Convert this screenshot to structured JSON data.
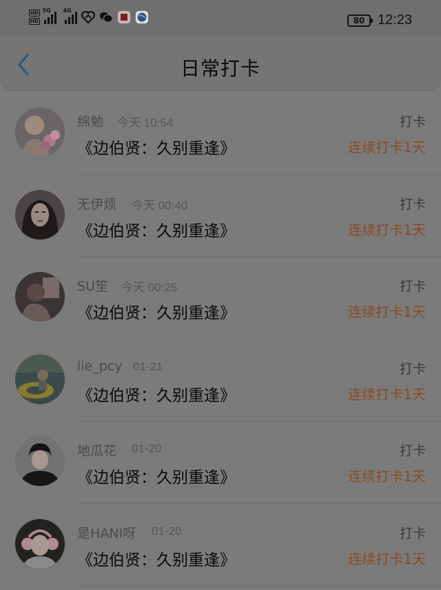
{
  "status_bar": {
    "hd1": "HD",
    "hd2": "HD",
    "net1": "5G",
    "net2": "4G",
    "battery": "80",
    "time": "12:23"
  },
  "header": {
    "title": "日常打卡"
  },
  "items": [
    {
      "username": "绵勉",
      "time": "今天 10:54",
      "book": "《边伯贤：久别重逢》",
      "action": "打卡",
      "streak": "连续打卡1天"
    },
    {
      "username": "无伊烦",
      "time": "今天 00:40",
      "book": "《边伯贤：久别重逢》",
      "action": "打卡",
      "streak": "连续打卡1天"
    },
    {
      "username": "SU笙",
      "time": "今天 00:25",
      "book": "《边伯贤：久别重逢》",
      "action": "打卡",
      "streak": "连续打卡1天"
    },
    {
      "username": "lie_pcy",
      "time": "01-21",
      "book": "《边伯贤：久别重逢》",
      "action": "打卡",
      "streak": "连续打卡1天"
    },
    {
      "username": "地瓜花",
      "time": "01-20",
      "book": "《边伯贤：久别重逢》",
      "action": "打卡",
      "streak": "连续打卡1天"
    },
    {
      "username": "是HANI呀",
      "time": "01-20",
      "book": "《边伯贤：久别重逢》",
      "action": "打卡",
      "streak": "连续打卡1天"
    }
  ],
  "colors": {
    "accent": "#8a4a22",
    "back_arrow": "#1f5a8c"
  }
}
